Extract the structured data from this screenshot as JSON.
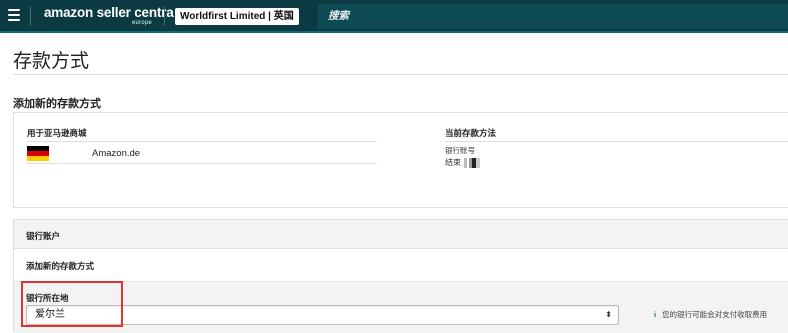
{
  "header": {
    "logo_brand": "amazon seller centra",
    "logo_sub": "europe",
    "account": "Worldfirst Limited | 英国",
    "search_placeholder": "搜索"
  },
  "page": {
    "title": "存款方式",
    "section_title": "添加新的存款方式"
  },
  "marketplace_card": {
    "left_header": "用于亚马逊商城",
    "marketplace": "Amazon.de",
    "flag": "germany-flag",
    "right_header": "当前存款方法",
    "bank_account_label": "银行账号",
    "ending_label": "结束"
  },
  "bank_card": {
    "row1": "银行账户",
    "row2": "添加新的存款方式",
    "location_label": "银行所在地",
    "location_value": "爱尔兰",
    "fee_note": "您的银行可能会对支付收取费用",
    "info_icon": "i"
  },
  "colors": {
    "topbar": "#0b3a43",
    "highlight": "#e5322d"
  }
}
